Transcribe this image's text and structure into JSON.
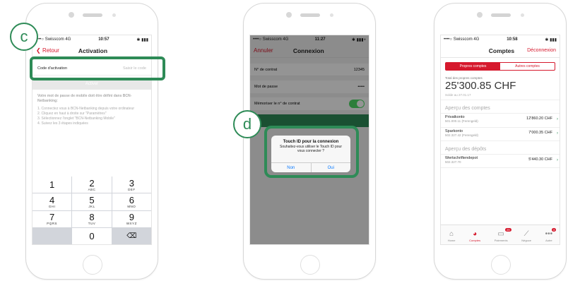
{
  "phone1": {
    "status": {
      "carrier": "••••○ Swisscom  4G",
      "time": "10:57",
      "right": "✱ ▮▮▮"
    },
    "nav": {
      "back_label": "Retour",
      "title": "Activation"
    },
    "field": {
      "label": "Code d'activation",
      "placeholder": "Saisir le code"
    },
    "activate_label": "Activer",
    "instructions": {
      "heading": "Votre mot de passe de mobile doit être défini dans BCN-Netbanking:",
      "steps": [
        "1. Connectez vous à BCN-Netbanking depuis votre ordinateur",
        "2. Cliquez en haut à droite sur \"Paramètres\"",
        "3. Sélectionnez l'onglet \"BCN-Netbanking Mobile\"",
        "4. Suivez les 3 étapes indiquées"
      ]
    },
    "keypad": [
      {
        "n": "1",
        "l": ""
      },
      {
        "n": "2",
        "l": "ABC"
      },
      {
        "n": "3",
        "l": "DEF"
      },
      {
        "n": "4",
        "l": "GHI"
      },
      {
        "n": "5",
        "l": "JKL"
      },
      {
        "n": "6",
        "l": "MNO"
      },
      {
        "n": "7",
        "l": "PQRS"
      },
      {
        "n": "8",
        "l": "TUV"
      },
      {
        "n": "9",
        "l": "WXYZ"
      },
      {
        "n": "",
        "l": ""
      },
      {
        "n": "0",
        "l": ""
      },
      {
        "n": "⌫",
        "l": ""
      }
    ],
    "step_badge": "c"
  },
  "phone2": {
    "status": {
      "carrier": "••••○ Swisscom  4G",
      "time": "11:27",
      "right": "✱ ▮▮▮+"
    },
    "nav": {
      "cancel_label": "Annuler",
      "title": "Connexion"
    },
    "rows": [
      {
        "label": "N° de contrat",
        "value": "12345"
      },
      {
        "label": "Mot de passe",
        "value": "•••••"
      }
    ],
    "remember_label": "Mémoriser le n° de contrat",
    "dialog": {
      "title": "Touch ID pour la connexion",
      "message": "Souhaitez-vous utiliser le Touch ID pour vous connecter ?",
      "no_label": "Non",
      "yes_label": "Oui"
    },
    "step_badge": "d"
  },
  "phone3": {
    "status": {
      "carrier": "••••○ Swisscom  4G",
      "time": "10:58",
      "right": "✱ ▮▮▮"
    },
    "nav": {
      "title": "Comptes",
      "logout_label": "Déconnexion"
    },
    "segments": {
      "own": "Propres comptes",
      "other": "Autres comptes"
    },
    "total": {
      "label": "Total des propres comptes",
      "amount": "25'300.85 CHF",
      "date": "Solde au 27.01.17"
    },
    "accounts_heading": "Aperçu des comptes",
    "accounts": [
      {
        "name": "Privatkonto",
        "number": "501.000.11 (Ferengeld)",
        "amount": "12'860.20 CHF"
      },
      {
        "name": "Sparkonto",
        "number": "502.327.42 (Ferengeld)",
        "amount": "7'000.35 CHF"
      }
    ],
    "deposits_heading": "Aperçu des dépôts",
    "deposits": [
      {
        "name": "Wertschriftendepot",
        "number": "502.327.70",
        "amount": "5'440.30 CHF"
      }
    ],
    "tabs": [
      {
        "icon": "⌂",
        "label": "Home"
      },
      {
        "icon": "◕",
        "label": "Comptes"
      },
      {
        "icon": "▭",
        "label": "Paiements",
        "count": "25"
      },
      {
        "icon": "⟋",
        "label": "Négoce"
      },
      {
        "icon": "•••",
        "label": "Autre",
        "count": "3"
      }
    ]
  },
  "colors": {
    "accent": "#d6192d",
    "highlight": "#2e8b57",
    "toggle": "#4cd964"
  }
}
